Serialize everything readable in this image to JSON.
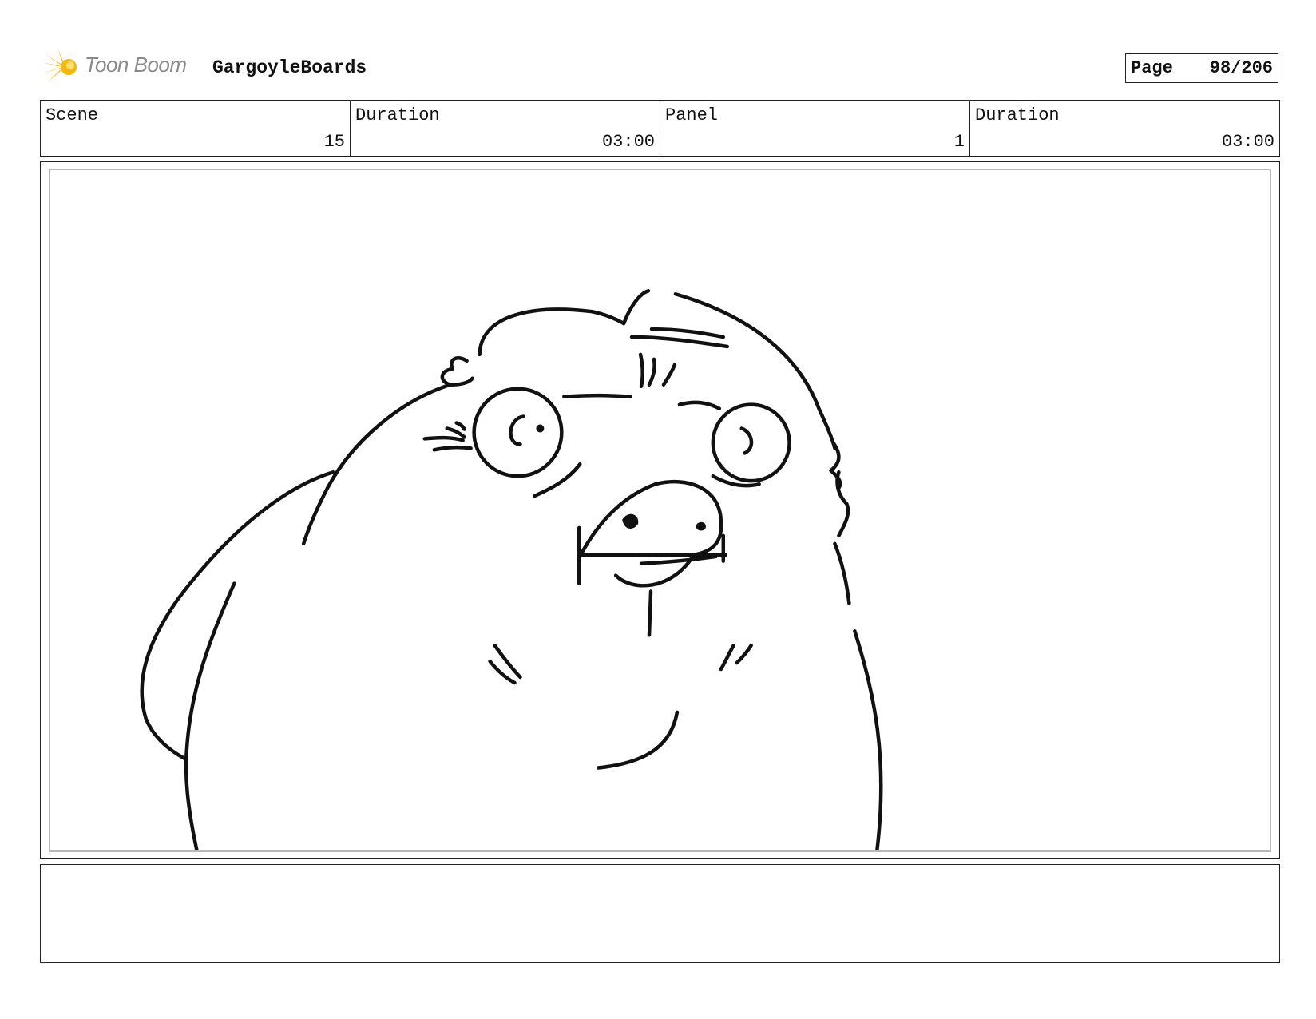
{
  "header": {
    "logo_text": "Toon Boom",
    "project": "GargoyleBoards",
    "page_label": "Page",
    "page_value": "98/206"
  },
  "info": {
    "scene_label": "Scene",
    "scene_value": "15",
    "scene_duration_label": "Duration",
    "scene_duration_value": "03:00",
    "panel_label": "Panel",
    "panel_value": "1",
    "panel_duration_label": "Duration",
    "panel_duration_value": "03:00"
  },
  "notes": {
    "text": ""
  },
  "colors": {
    "logo_star": "#f5b80f",
    "logo_text": "#8a8a8a",
    "ink": "#111111",
    "inner_border": "#b8b8b8"
  }
}
